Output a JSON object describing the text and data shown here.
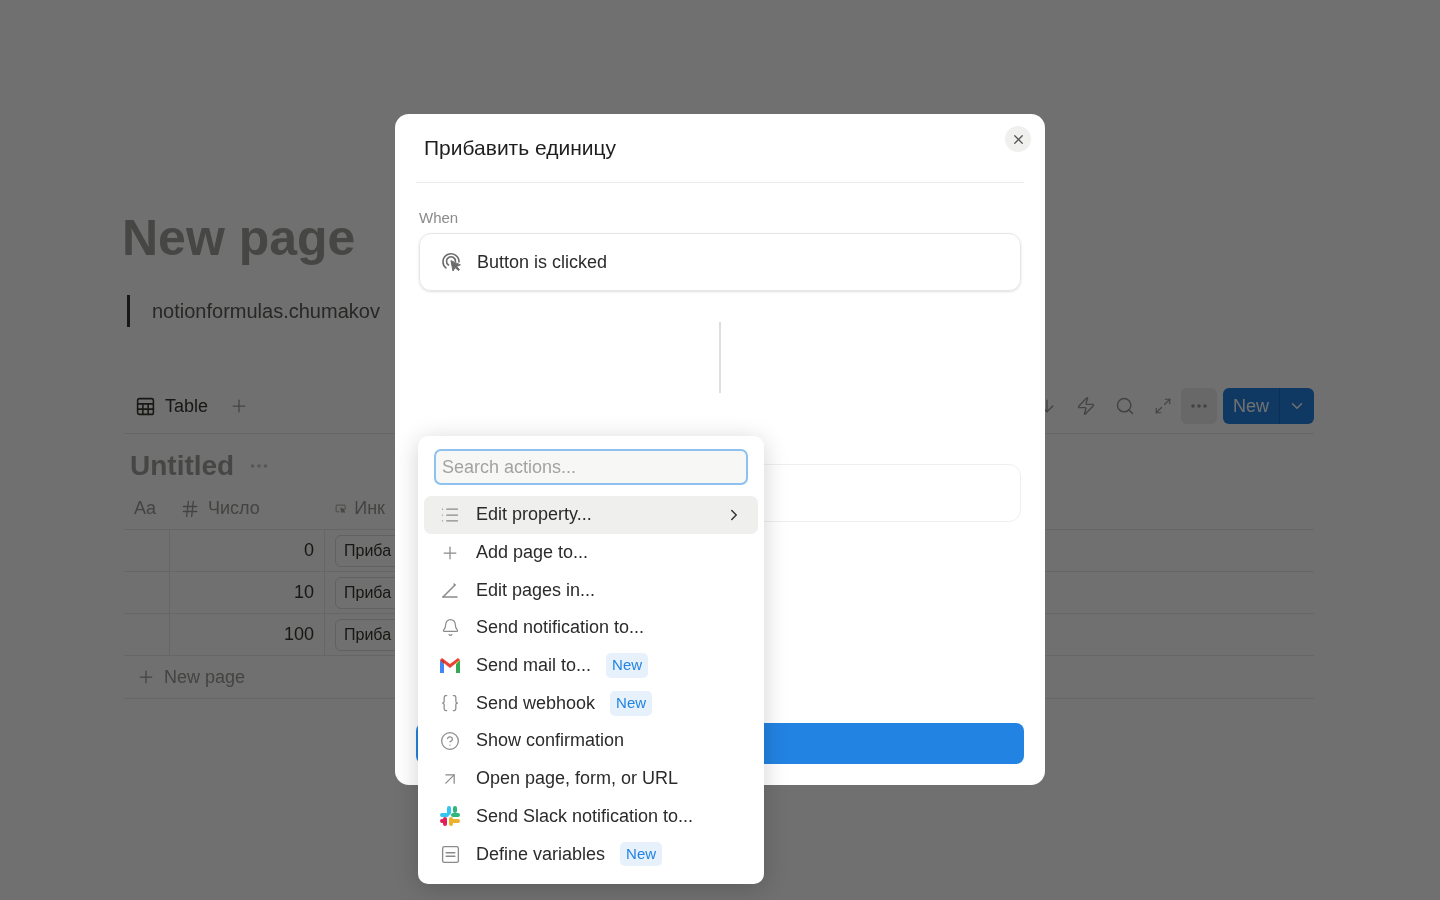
{
  "page": {
    "title": "New page",
    "quote": "notionformulas.chumakov",
    "view_tab": "Table",
    "new_button": "New",
    "database_title": "Untitled",
    "columns": [
      {
        "kind": "title",
        "label": "Aa"
      },
      {
        "kind": "number",
        "label": "Число"
      },
      {
        "kind": "button",
        "label": "Инк"
      }
    ],
    "rows": [
      {
        "number": "0",
        "button": "Приба"
      },
      {
        "number": "10",
        "button": "Приба"
      },
      {
        "number": "100",
        "button": "Приба"
      }
    ],
    "new_row": "New page"
  },
  "modal": {
    "title": "Прибавить единицу",
    "trigger_label": "When",
    "trigger": "Button is clicked"
  },
  "action_menu": {
    "search": {
      "placeholder": "Search actions..."
    },
    "items": [
      {
        "label": "Edit property...",
        "selected": true,
        "submenu": true
      },
      {
        "label": "Add page to...",
        "selected": false,
        "submenu": false
      },
      {
        "label": "Edit pages in...",
        "selected": false,
        "submenu": false
      },
      {
        "label": "Send notification to...",
        "selected": false,
        "submenu": false
      },
      {
        "label": "Send mail to...",
        "selected": false,
        "submenu": false,
        "badge": "New"
      },
      {
        "label": "Send webhook",
        "selected": false,
        "submenu": false,
        "badge": "New"
      },
      {
        "label": "Show confirmation",
        "selected": false,
        "submenu": false
      },
      {
        "label": "Open page, form, or URL",
        "selected": false,
        "submenu": false
      },
      {
        "label": "Send Slack notification to...",
        "selected": false,
        "submenu": false
      },
      {
        "label": "Define variables",
        "selected": false,
        "submenu": false,
        "badge": "New"
      }
    ]
  }
}
